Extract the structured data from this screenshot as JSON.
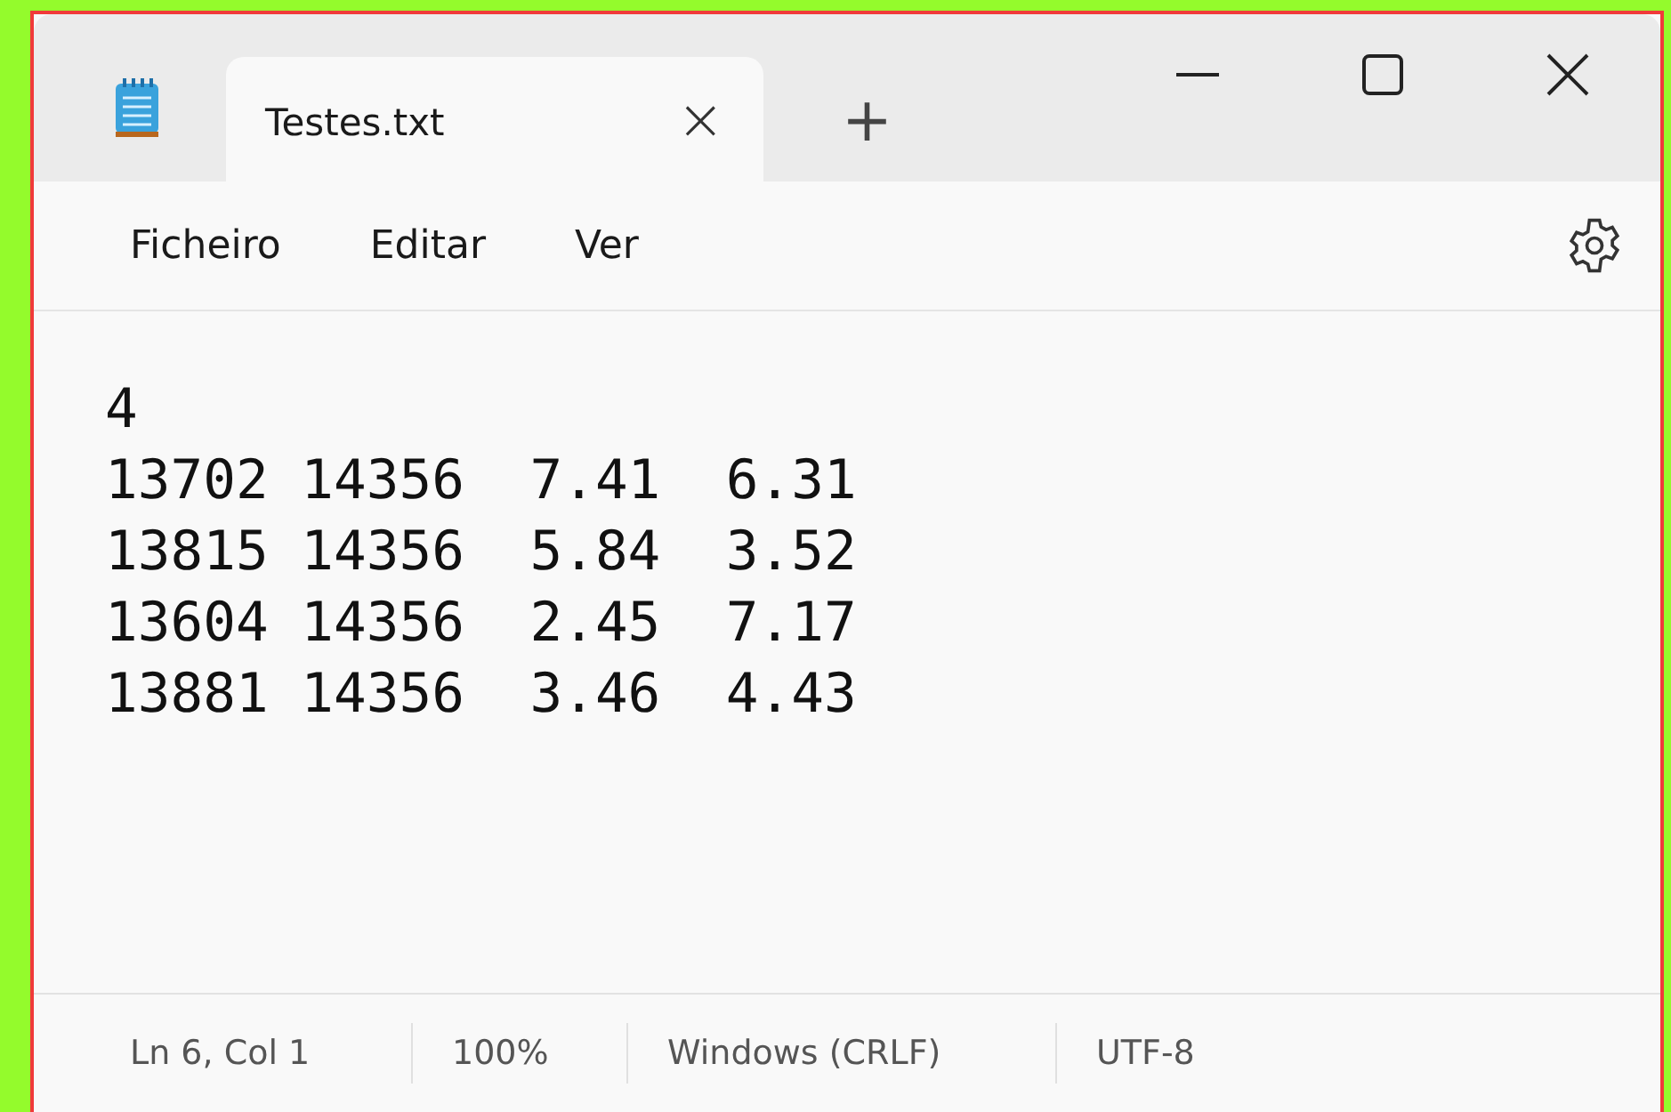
{
  "tabs": [
    {
      "label": "Testes.txt",
      "selected": true,
      "close": "×"
    }
  ],
  "new_tab": "+",
  "menu": [
    "Ficheiro",
    "Editar",
    "Ver"
  ],
  "document": {
    "lines": [
      "4",
      "13702 14356  7.41  6.31",
      "13815 14356  5.84  3.52",
      "13604 14356  2.45  7.17",
      "13881 14356  3.46  4.43"
    ]
  },
  "status_bar": [
    "Ln 6, Col 1",
    "100%",
    "Windows (CRLF)",
    "UTF-8"
  ]
}
